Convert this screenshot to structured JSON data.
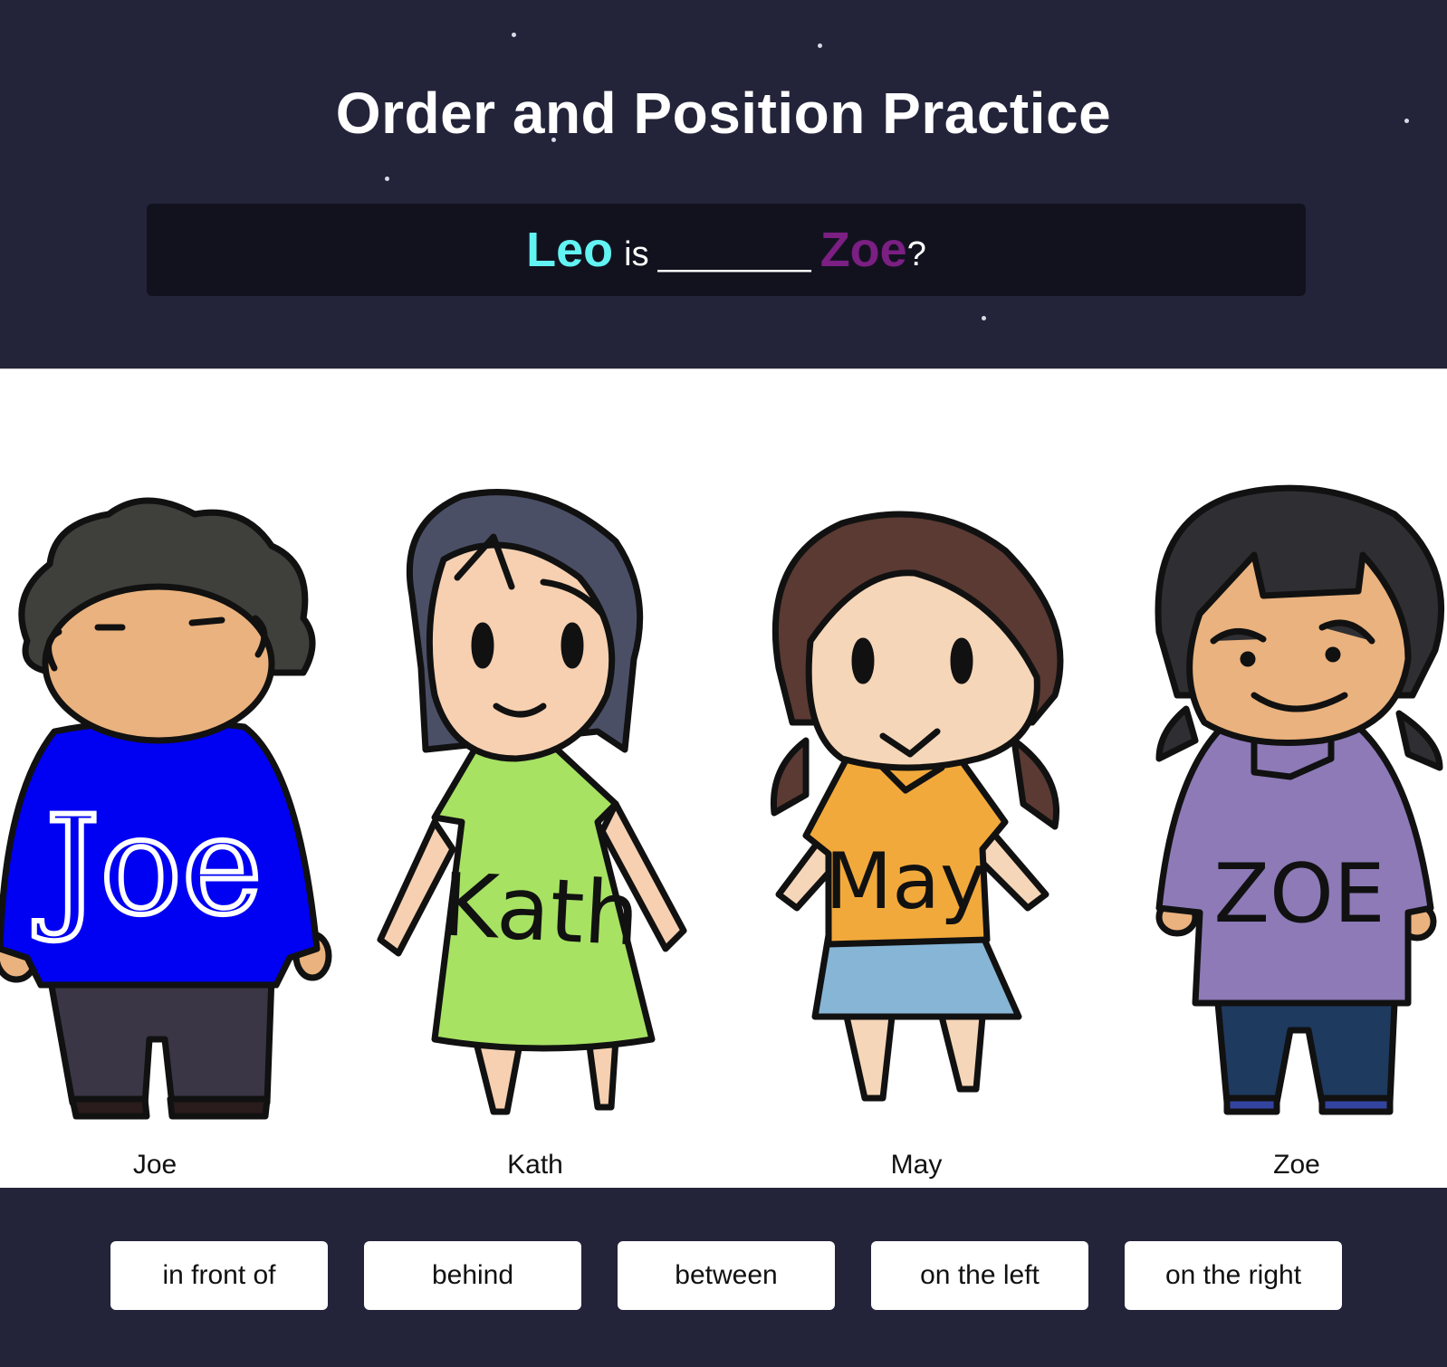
{
  "page": {
    "title": "Order and Position Practice"
  },
  "question": {
    "subject": "Leo",
    "verb": "is",
    "blank": "________",
    "object": "Zoe",
    "end": "?",
    "subject_color": "#62f3f3",
    "object_color": "#7b1f83"
  },
  "characters": [
    {
      "name": "Joe",
      "shirt_text": "Joe",
      "shirt_color": "#0000f2"
    },
    {
      "name": "Kath",
      "shirt_text": "Kath",
      "shirt_color": "#a7e263"
    },
    {
      "name": "May",
      "shirt_text": "May",
      "shirt_color": "#f2a93b"
    },
    {
      "name": "Zoe",
      "shirt_text": "ZOE",
      "shirt_color": "#8d7ab7"
    }
  ],
  "options": [
    "in front of",
    "behind",
    "between",
    "on the left",
    "on the right"
  ]
}
